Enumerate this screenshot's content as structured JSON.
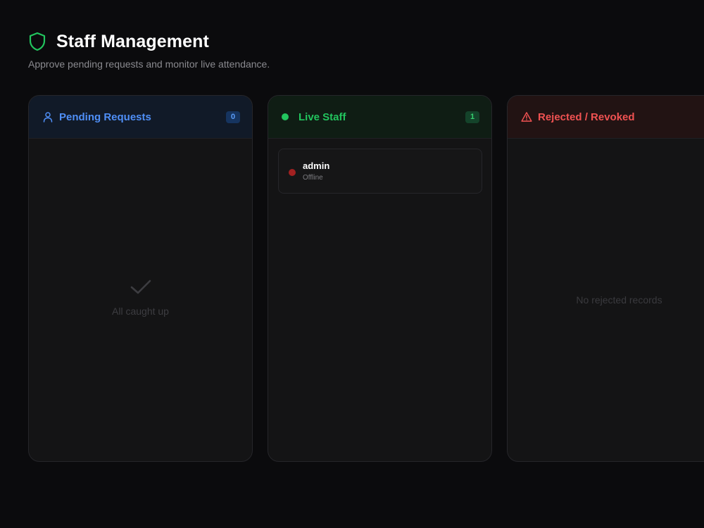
{
  "header": {
    "title": "Staff Management",
    "subtitle": "Approve pending requests and monitor live attendance.",
    "icon": "shield-icon",
    "accent": "#22c55e"
  },
  "columns": {
    "pending": {
      "title": "Pending Requests",
      "count": "0",
      "icon": "user-icon",
      "color": "#4f8ff7",
      "empty_icon": "check-icon",
      "empty_text": "All caught up"
    },
    "live": {
      "title": "Live Staff",
      "count": "1",
      "icon": "live-dot-icon",
      "color": "#22c55e",
      "staff": [
        {
          "name": "admin",
          "status": "Offline",
          "status_color": "#a32121"
        }
      ]
    },
    "rejected": {
      "title": "Rejected / Revoked",
      "icon": "warning-icon",
      "color": "#f05252",
      "empty_text": "No rejected records"
    }
  }
}
